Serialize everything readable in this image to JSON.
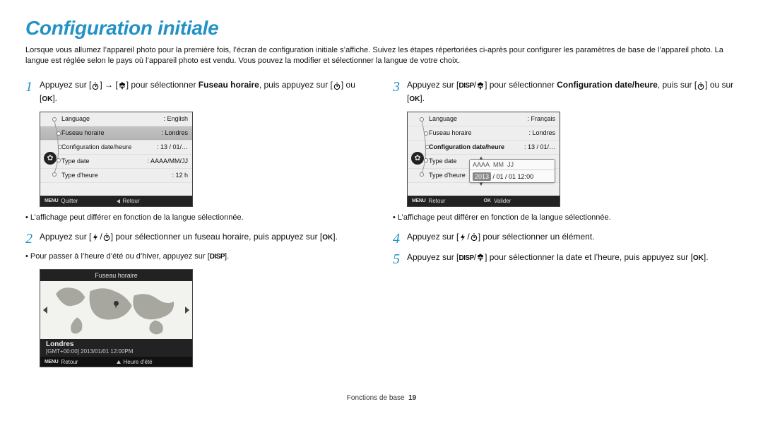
{
  "title": "Configuration initiale",
  "intro": "Lorsque vous allumez l’appareil photo pour la première fois, l’écran de configuration initiale s’affiche. Suivez les étapes répertoriées ci-après pour configurer les paramètres de base de l’appareil photo. La langue est réglée selon le pays où l’appareil photo est vendu. Vous pouvez la modifier et sélectionner la langue de votre choix.",
  "steps": {
    "s1": {
      "num": "1",
      "pre": "Appuyez sur [",
      "mid1": "] → [",
      "mid2": "] pour sélectionner ",
      "bold": "Fuseau horaire",
      "post1": ", puis appuyez sur [",
      "post2": "] ou [",
      "end": "]."
    },
    "s2": {
      "num": "2",
      "pre": "Appuyez sur [",
      "sep": "/",
      "mid": "] pour sélectionner un fuseau horaire, puis appuyez sur [",
      "end": "].",
      "note": "Pour passer à l’heure d’été ou d’hiver, appuyez sur [",
      "note_end": "]."
    },
    "s3": {
      "num": "3",
      "pre": "Appuyez sur [",
      "sep": "/",
      "mid": "] pour sélectionner ",
      "bold": "Configuration date/heure",
      "post1": ", puis sur [",
      "post2": "] ou sur [",
      "end": "]."
    },
    "s4": {
      "num": "4",
      "pre": "Appuyez sur [",
      "sep": "/",
      "end": "] pour sélectionner un élément."
    },
    "s5": {
      "num": "5",
      "pre": "Appuyez sur [",
      "sep": "/",
      "mid": "] pour sélectionner la date et l’heure, puis appuyez sur [",
      "end": "]."
    }
  },
  "note_affichage": "L’affichage peut différer en fonction de la langue sélectionnée.",
  "screen1": {
    "rows": [
      {
        "label": "Language",
        "value": "English"
      },
      {
        "label": "Fuseau horaire",
        "value": "Londres",
        "selected": true
      },
      {
        "label": "Configuration date/heure",
        "value": "13 / 01/…"
      },
      {
        "label": "Type date",
        "value": "AAAA/MM/JJ"
      },
      {
        "label": "Type d'heure",
        "value": "12 h"
      }
    ],
    "bar_left_label": "Quitter",
    "bar_right_label": "Retour"
  },
  "screen2": {
    "title": "Fuseau horaire",
    "location": "Londres",
    "gmt": "[GMT+00:00]    2013/01/01   12:00PM",
    "bar_left_label": "Retour",
    "bar_right_label": "Heure d'été"
  },
  "screen3": {
    "rows": [
      {
        "label": "Language",
        "value": "Français"
      },
      {
        "label": "Fuseau horaire",
        "value": "Londres"
      },
      {
        "label": "Configuration date/heure",
        "value": "13 / 01/…",
        "bold": true
      },
      {
        "label": "Type date",
        "value": ""
      },
      {
        "label": "Type d'heure",
        "value": ""
      }
    ],
    "bar_left_label": "Retour",
    "bar_right_label": "Valider",
    "datebox_head": [
      "AAAA",
      "MM",
      "JJ"
    ],
    "datebox_body_hi": "2013",
    "datebox_body_rest": " / 01 / 01 12:00"
  },
  "ok_label": "OK",
  "disp_label": "DISP",
  "menu_label": "MENU",
  "footer": {
    "section": "Fonctions de base",
    "page": "19"
  }
}
